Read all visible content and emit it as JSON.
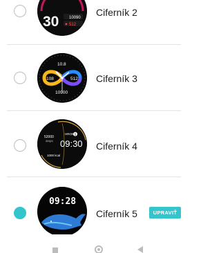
{
  "colors": {
    "accent": "#33c4cc",
    "radio_border": "#bdbdbd",
    "divider": "#e3e3e3",
    "nav_icon": "#bcbcbc"
  },
  "watch_faces": [
    {
      "label": "Ciferník 2",
      "selected": false,
      "face_texts": {
        "time": "30",
        "steps": "10090",
        "heart": "512"
      }
    },
    {
      "label": "Ciferník 3",
      "selected": false,
      "face_texts": {
        "top": "10.8",
        "left": "108",
        "right": "512",
        "bottom": "10900"
      }
    },
    {
      "label": "Ciferník 4",
      "selected": false,
      "face_texts": {
        "steps_value": "52000",
        "steps_unit": "steps",
        "hr_label": "HRON",
        "hr_badge": "5",
        "time": "09:30",
        "kcal": "1000 kcal"
      }
    },
    {
      "label": "Ciferník 5",
      "selected": true,
      "face_texts": {
        "time": "09:28"
      }
    }
  ],
  "edit_button": {
    "label": "UPRAVIŤ"
  },
  "navbar": {
    "recent_icon": "square-icon",
    "home_icon": "circle-home-icon",
    "back_icon": "triangle-back-icon"
  }
}
